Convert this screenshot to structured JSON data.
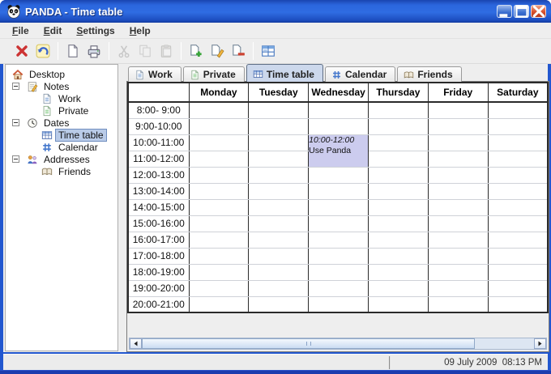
{
  "window": {
    "title": "PANDA - Time table",
    "app_icon": "panda-icon",
    "controls": [
      {
        "name": "minimize",
        "icon": "minimize-icon"
      },
      {
        "name": "maximize",
        "icon": "maximize-icon"
      },
      {
        "name": "close",
        "icon": "close-icon"
      }
    ]
  },
  "menu": {
    "items": [
      "File",
      "Edit",
      "Settings",
      "Help"
    ]
  },
  "toolbar": {
    "groups": [
      {
        "buttons": [
          {
            "name": "exit",
            "icon": "exit-icon",
            "enabled": true
          },
          {
            "name": "undo",
            "icon": "undo-icon",
            "enabled": true
          }
        ]
      },
      {
        "buttons": [
          {
            "name": "new",
            "icon": "new-document-icon",
            "enabled": true
          },
          {
            "name": "print",
            "icon": "print-icon",
            "enabled": true
          }
        ]
      },
      {
        "buttons": [
          {
            "name": "cut",
            "icon": "cut-icon",
            "enabled": false
          },
          {
            "name": "copy",
            "icon": "copy-icon",
            "enabled": false
          },
          {
            "name": "paste",
            "icon": "paste-icon",
            "enabled": false
          }
        ]
      },
      {
        "buttons": [
          {
            "name": "add-entry",
            "icon": "add-item-icon",
            "enabled": true
          },
          {
            "name": "edit-entry",
            "icon": "edit-item-icon",
            "enabled": true
          },
          {
            "name": "remove-entry",
            "icon": "remove-item-icon",
            "enabled": true
          }
        ]
      },
      {
        "buttons": [
          {
            "name": "timetable-view",
            "icon": "table-view-icon",
            "enabled": true
          }
        ]
      }
    ]
  },
  "sidebar": {
    "items": [
      {
        "label": "Desktop",
        "icon": "desktop-house-icon",
        "level": 0,
        "expander": false,
        "selected": false
      },
      {
        "label": "Notes",
        "icon": "notes-icon",
        "level": 1,
        "expander": true,
        "selected": false
      },
      {
        "label": "Work",
        "icon": "work-note-icon",
        "level": 2,
        "expander": false,
        "selected": false
      },
      {
        "label": "Private",
        "icon": "private-note-icon",
        "level": 2,
        "expander": false,
        "selected": false
      },
      {
        "label": "Dates",
        "icon": "dates-clock-icon",
        "level": 1,
        "expander": true,
        "selected": false
      },
      {
        "label": "Time table",
        "icon": "timetable-icon",
        "level": 2,
        "expander": false,
        "selected": true
      },
      {
        "label": "Calendar",
        "icon": "calendar-grid-icon",
        "level": 2,
        "expander": false,
        "selected": false
      },
      {
        "label": "Addresses",
        "icon": "addresses-icon",
        "level": 1,
        "expander": true,
        "selected": false
      },
      {
        "label": "Friends",
        "icon": "friends-book-icon",
        "level": 2,
        "expander": false,
        "selected": false
      }
    ]
  },
  "tabs": [
    {
      "label": "Work",
      "icon": "work-note-icon",
      "selected": false
    },
    {
      "label": "Private",
      "icon": "private-note-icon",
      "selected": false
    },
    {
      "label": "Time table",
      "icon": "timetable-icon",
      "selected": true
    },
    {
      "label": "Calendar",
      "icon": "calendar-grid-icon",
      "selected": false
    },
    {
      "label": "Friends",
      "icon": "friends-book-icon",
      "selected": false
    }
  ],
  "timetable": {
    "day_columns": [
      "Monday",
      "Tuesday",
      "Wednesday",
      "Thursday",
      "Friday",
      "Saturday"
    ],
    "time_slots": [
      "8:00- 9:00",
      "9:00-10:00",
      "10:00-11:00",
      "11:00-12:00",
      "12:00-13:00",
      "13:00-14:00",
      "14:00-15:00",
      "15:00-16:00",
      "16:00-17:00",
      "17:00-18:00",
      "18:00-19:00",
      "19:00-20:00",
      "20:00-21:00"
    ],
    "events": [
      {
        "day": "Wednesday",
        "day_index": 2,
        "slot_index": 2,
        "slot_span": 2,
        "time_label": "10:00-12:00",
        "title": "Use Panda"
      }
    ]
  },
  "statusbar": {
    "datetime": "09 July 2009  08:13 PM"
  },
  "colors": {
    "titlebar_blue": "#2b66dd",
    "window_frame_blue": "#2257cf",
    "tree_selection_blue": "#b9cbe8",
    "tab_selected_blue": "#ccd8ec",
    "event_lavender": "#ccccee",
    "close_button_red": "#d9512c"
  }
}
